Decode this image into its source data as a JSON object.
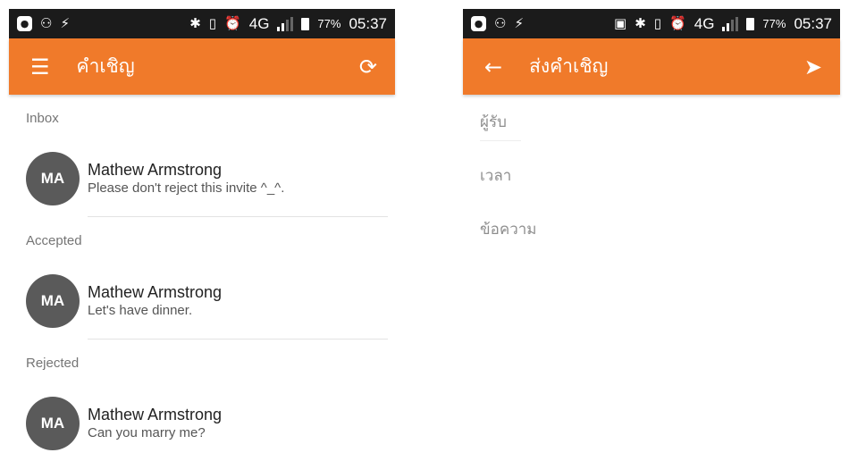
{
  "left_screen": {
    "status_bar": {
      "app_icon": "circle-app-icon",
      "icons": [
        "usb-debug-icon",
        "flash-icon",
        "bluetooth-icon",
        "vibrate-icon",
        "alarm-icon"
      ],
      "network": "4G",
      "battery": "77%",
      "time": "05:37"
    },
    "app_bar": {
      "menu_icon": "hamburger-menu-icon",
      "title": "คำเชิญ",
      "refresh_icon": "sync-icon",
      "color": "#f07a2a"
    },
    "sections": [
      {
        "header": "Inbox",
        "items": [
          {
            "initials": "MA",
            "name": "Mathew Armstrong",
            "message": "Please don't reject this invite ^_^."
          }
        ]
      },
      {
        "header": "Accepted",
        "items": [
          {
            "initials": "MA",
            "name": "Mathew Armstrong",
            "message": "Let's have dinner."
          }
        ]
      },
      {
        "header": "Rejected",
        "items": [
          {
            "initials": "MA",
            "name": "Mathew Armstrong",
            "message": "Can you marry me?"
          }
        ]
      }
    ]
  },
  "right_screen": {
    "status_bar": {
      "app_icon": "circle-app-icon",
      "icons": [
        "usb-debug-icon",
        "flash-icon",
        "cast-icon",
        "bluetooth-icon",
        "vibrate-icon",
        "alarm-icon"
      ],
      "network": "4G",
      "battery": "77%",
      "time": "05:37"
    },
    "app_bar": {
      "back_icon": "back-arrow-icon",
      "title": "ส่งคำเชิญ",
      "send_icon": "send-icon",
      "color": "#f07a2a"
    },
    "fields": [
      {
        "label": "ผู้รับ"
      },
      {
        "label": "เวลา"
      },
      {
        "label": "ข้อความ"
      }
    ]
  }
}
